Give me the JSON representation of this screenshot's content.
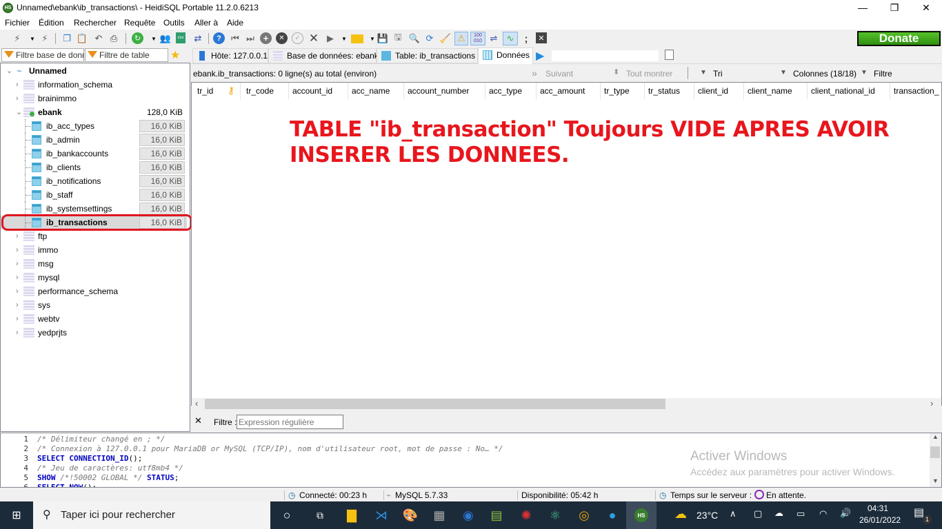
{
  "window": {
    "title": "Unnamed\\ebank\\ib_transactions\\ - HeidiSQL Portable 11.2.0.6213",
    "app_icon": "HS",
    "minimize": "—",
    "restore": "❐",
    "close": "✕"
  },
  "menu": [
    "Fichier",
    "Édition",
    "Rechercher",
    "Requête",
    "Outils",
    "Aller à",
    "Aide"
  ],
  "toolbar": {
    "icons": [
      "connect-icon",
      "dropdown-icon",
      "disconnect-icon",
      "copy-icon",
      "paste-icon",
      "undo-icon",
      "print-icon",
      "refresh-icon",
      "dropdown-icon",
      "user-manager-icon",
      "export-csv-icon",
      "import-icon",
      "help-icon",
      "first-record-icon",
      "last-record-icon",
      "add-row-icon",
      "delete-row-icon",
      "post-icon",
      "cancel-icon",
      "run-icon",
      "dropdown-icon",
      "open-folder-icon",
      "dropdown-icon",
      "save-icon",
      "save-as-icon",
      "find-icon",
      "replace-icon",
      "clean-icon",
      "warning-icon",
      "binary-icon",
      "wrap-icon",
      "sync-icon",
      "semicolon-icon",
      "stop-icon"
    ],
    "donate_label": "Donate"
  },
  "filters": {
    "database_placeholder": "Filtre base de donr",
    "table_placeholder": "Filtre de table"
  },
  "tabs": [
    {
      "label": "Hôte: 127.0.0.1",
      "icon": "server-icon"
    },
    {
      "label": "Base de données: ebank",
      "icon": "database-icon"
    },
    {
      "label": "Table: ib_transactions",
      "icon": "table-icon"
    },
    {
      "label": "Données",
      "icon": "grid-icon",
      "active": true
    }
  ],
  "query_input": "",
  "tree": {
    "root": "Unnamed",
    "databases": [
      {
        "name": "information_schema"
      },
      {
        "name": "brainimmo"
      },
      {
        "name": "ebank",
        "size": "128,0 KiB",
        "expanded": true,
        "tables": [
          {
            "name": "ib_acc_types",
            "size": "16,0 KiB"
          },
          {
            "name": "ib_admin",
            "size": "16,0 KiB"
          },
          {
            "name": "ib_bankaccounts",
            "size": "16,0 KiB"
          },
          {
            "name": "ib_clients",
            "size": "16,0 KiB"
          },
          {
            "name": "ib_notifications",
            "size": "16,0 KiB"
          },
          {
            "name": "ib_staff",
            "size": "16,0 KiB"
          },
          {
            "name": "ib_systemsettings",
            "size": "16,0 KiB"
          },
          {
            "name": "ib_transactions",
            "size": "16,0 KiB",
            "selected": true
          }
        ]
      },
      {
        "name": "ftp"
      },
      {
        "name": "immo"
      },
      {
        "name": "msg"
      },
      {
        "name": "mysql"
      },
      {
        "name": "performance_schema"
      },
      {
        "name": "sys"
      },
      {
        "name": "webtv"
      },
      {
        "name": "yedprjts"
      }
    ]
  },
  "data_view": {
    "info": "ebank.ib_transactions: 0 ligne(s) au total (environ)",
    "next_label": "Suivant",
    "show_all_label": "Tout montrer",
    "sort_label": "Tri",
    "columns_label": "Colonnes (18/18)",
    "filter_label": "Filtre",
    "columns": [
      "tr_id",
      "tr_code",
      "account_id",
      "acc_name",
      "account_number",
      "acc_type",
      "acc_amount",
      "tr_type",
      "tr_status",
      "client_id",
      "client_name",
      "client_national_id",
      "transaction_"
    ],
    "rows": []
  },
  "annotation": {
    "line1": "TABLE \"ib_transaction\" Toujours VIDE APRES AVOIR",
    "line2": "INSERER LES DONNEES.",
    "color": "#e8161d"
  },
  "filter_bar": {
    "close": "✕",
    "label": "Filtre :",
    "placeholder": "Expression régulière"
  },
  "log": [
    {
      "n": "1",
      "html": "<span class='cm'>/* Délimiteur changé en ; */</span>"
    },
    {
      "n": "2",
      "html": "<span class='cm'>/* Connexion à 127.0.0.1 pour MariaDB or MySQL (TCP/IP), nom d'utilisateur root, mot de passe : No… */</span>"
    },
    {
      "n": "3",
      "html": "<span class='kw'>SELECT CONNECTION_ID</span>();"
    },
    {
      "n": "4",
      "html": "<span class='cm'>/* Jeu de caractères: utf8mb4 */</span>"
    },
    {
      "n": "5",
      "html": "<span class='kw'>SHOW</span> <span class='cm'>/*!50002 GLOBAL */</span> <span class='kw'>STATUS</span>;"
    },
    {
      "n": "6",
      "html": "<span class='kw'>SELECT NOW</span>();"
    }
  ],
  "watermark": {
    "title": "Activer Windows",
    "subtitle": "Accédez aux paramètres pour activer Windows."
  },
  "status": {
    "connected": "Connecté: 00:23 h",
    "server": "MySQL 5.7.33",
    "uptime": "Disponibilité: 05:42 h",
    "server_time": "Temps sur le serveur :",
    "state": "En attente."
  },
  "taskbar": {
    "search_placeholder": "Taper ici pour rechercher",
    "weather": "23°C",
    "time": "04:31",
    "date": "26/01/2022",
    "notifications": "1",
    "apps": [
      "cortana-icon",
      "task-view-icon",
      "file-explorer-icon",
      "vscode-icon",
      "paint-icon",
      "calculator-icon",
      "app-icon",
      "notepad-plus-icon",
      "usb-fix-icon",
      "atom-icon",
      "chrome-icon",
      "elephant-icon",
      "heidisql-icon"
    ]
  }
}
